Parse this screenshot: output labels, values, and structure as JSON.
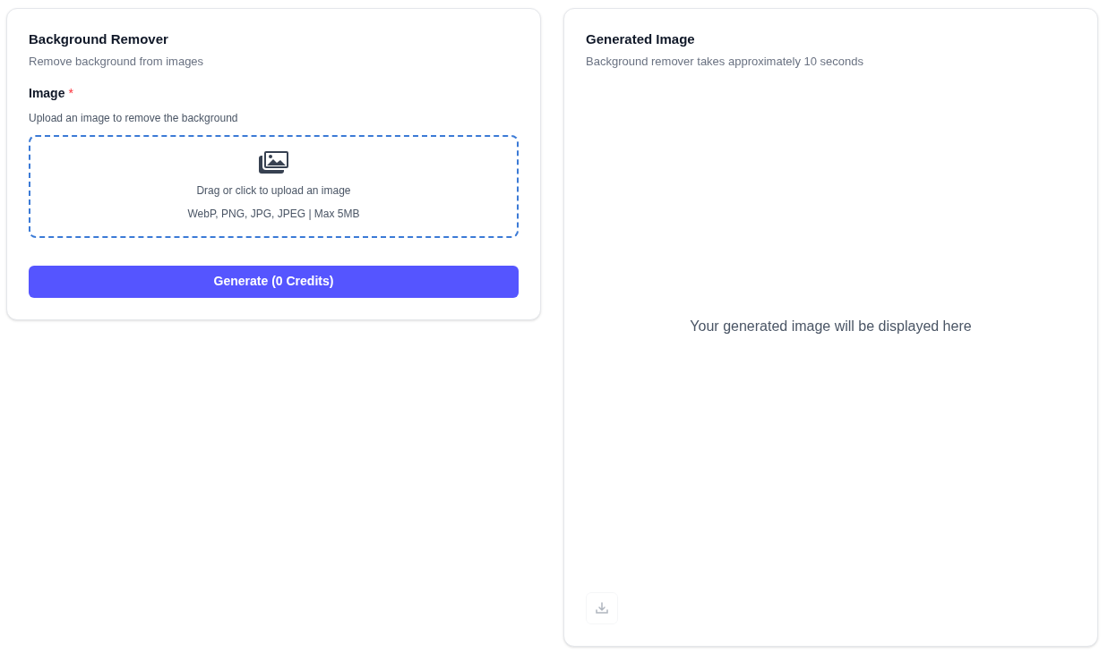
{
  "form_card": {
    "title": "Background Remover",
    "subtitle": "Remove background from images",
    "field": {
      "label": "Image",
      "required_mark": "*",
      "help": "Upload an image to remove the background",
      "dropzone": {
        "text": "Drag or click to upload an image",
        "formats": "WebP, PNG, JPG, JPEG | Max 5MB"
      }
    },
    "button": "Generate (0 Credits)"
  },
  "result_card": {
    "title": "Generated Image",
    "subtitle": "Background remover takes approximately 10 seconds",
    "placeholder": "Your generated image will be displayed here",
    "download": {
      "disabled": true
    }
  }
}
